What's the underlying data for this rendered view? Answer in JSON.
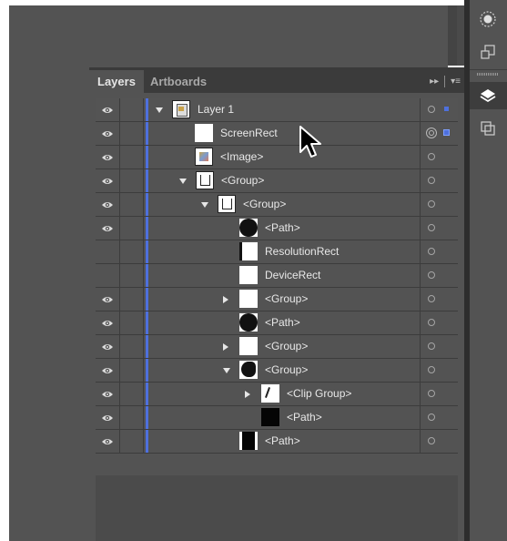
{
  "panel": {
    "tabs": [
      {
        "label": "Layers",
        "active": true
      },
      {
        "label": "Artboards",
        "active": false
      }
    ],
    "menu_icons": [
      "fast-forward-icon",
      "panel-menu-icon"
    ]
  },
  "dock": {
    "icons": [
      "brightness-icon",
      "artboard-export-icon",
      "layers-icon",
      "pathfinder-icon"
    ],
    "selected": "layers-icon"
  },
  "layers": {
    "color": "#4e70dd",
    "rows": [
      {
        "label": "Layer 1",
        "visible": true,
        "expanded": true,
        "thumb": "layer-thumb",
        "selected_indicator": true
      },
      {
        "label": "ScreenRect",
        "visible": true,
        "thumb": "white-rect",
        "target": "selected",
        "selected_indicator": true
      },
      {
        "label": "<Image>",
        "visible": true,
        "thumb": "image-thumb"
      },
      {
        "label": "<Group>",
        "visible": true,
        "expanded": true,
        "thumb": "group-thumb"
      },
      {
        "label": "<Group>",
        "visible": true,
        "expanded": true,
        "thumb": "group-thumb"
      },
      {
        "label": "<Path>",
        "visible": true,
        "thumb": "black-circle"
      },
      {
        "label": "ResolutionRect",
        "visible": false,
        "thumb": "white-rect-lined"
      },
      {
        "label": "DeviceRect",
        "visible": false,
        "thumb": "white-rect"
      },
      {
        "label": "<Group>",
        "visible": true,
        "expanded": false,
        "thumb": "white-rect"
      },
      {
        "label": "<Path>",
        "visible": true,
        "thumb": "black-circle"
      },
      {
        "label": "<Group>",
        "visible": true,
        "expanded": false,
        "thumb": "white-rect"
      },
      {
        "label": "<Group>",
        "visible": true,
        "expanded": true,
        "thumb": "black-blob"
      },
      {
        "label": "<Clip Group>",
        "visible": true,
        "expanded": false,
        "thumb": "clip-thumb"
      },
      {
        "label": "<Path>",
        "visible": true,
        "thumb": "black-rect"
      },
      {
        "label": "<Path>",
        "visible": true,
        "thumb": "black-rect-lined"
      }
    ]
  }
}
